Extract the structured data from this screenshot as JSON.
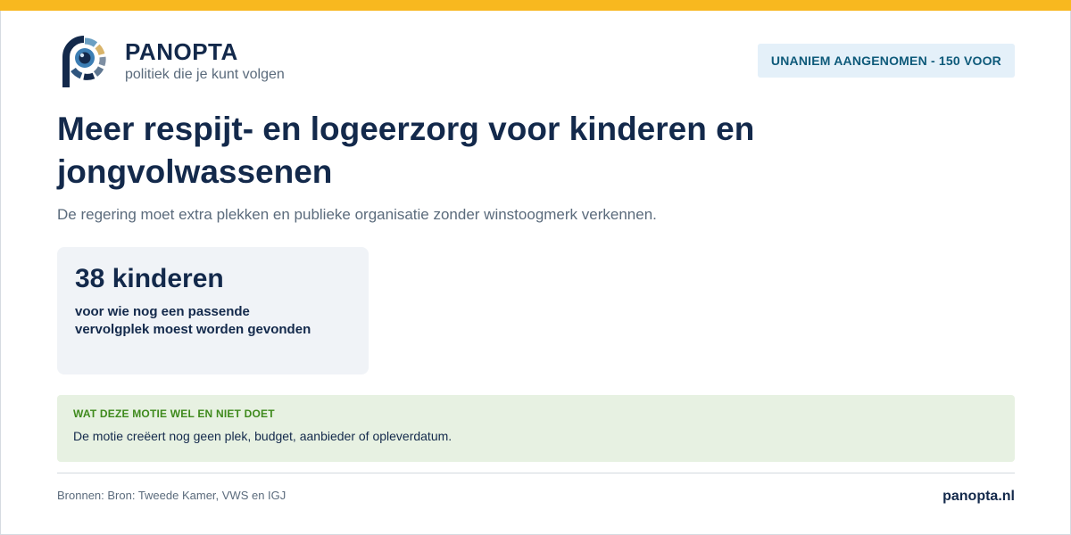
{
  "brand": {
    "name": "PANOPTA",
    "tagline": "politiek die je kunt volgen"
  },
  "status": {
    "label": "UNANIEM AANGENOMEN - 150 VOOR"
  },
  "motion": {
    "title": "Meer respijt- en logeerzorg voor kinderen en jongvolwassenen",
    "summary": "De regering moet extra plekken en publieke organisatie zonder winstoogmerk verkennen."
  },
  "stat": {
    "value": "38 kinderen",
    "description": "voor wie nog een passende vervolgplek moest worden gevonden"
  },
  "note": {
    "heading": "WAT DEZE MOTIE WEL EN NIET DOET",
    "text": "De motie creëert nog geen plek, budget, aanbieder of opleverdatum."
  },
  "footer": {
    "sources": "Bronnen: Bron: Tweede Kamer, VWS en IGJ",
    "site": "panopta.nl"
  },
  "colors": {
    "accent_bar": "#f8b81f",
    "navy": "#13294b",
    "badge_bg": "#e4f0f9",
    "note_bg": "#e7f1e2",
    "note_heading": "#3f8a1d"
  },
  "icons": {
    "logo": "panopta-eye-logo"
  }
}
